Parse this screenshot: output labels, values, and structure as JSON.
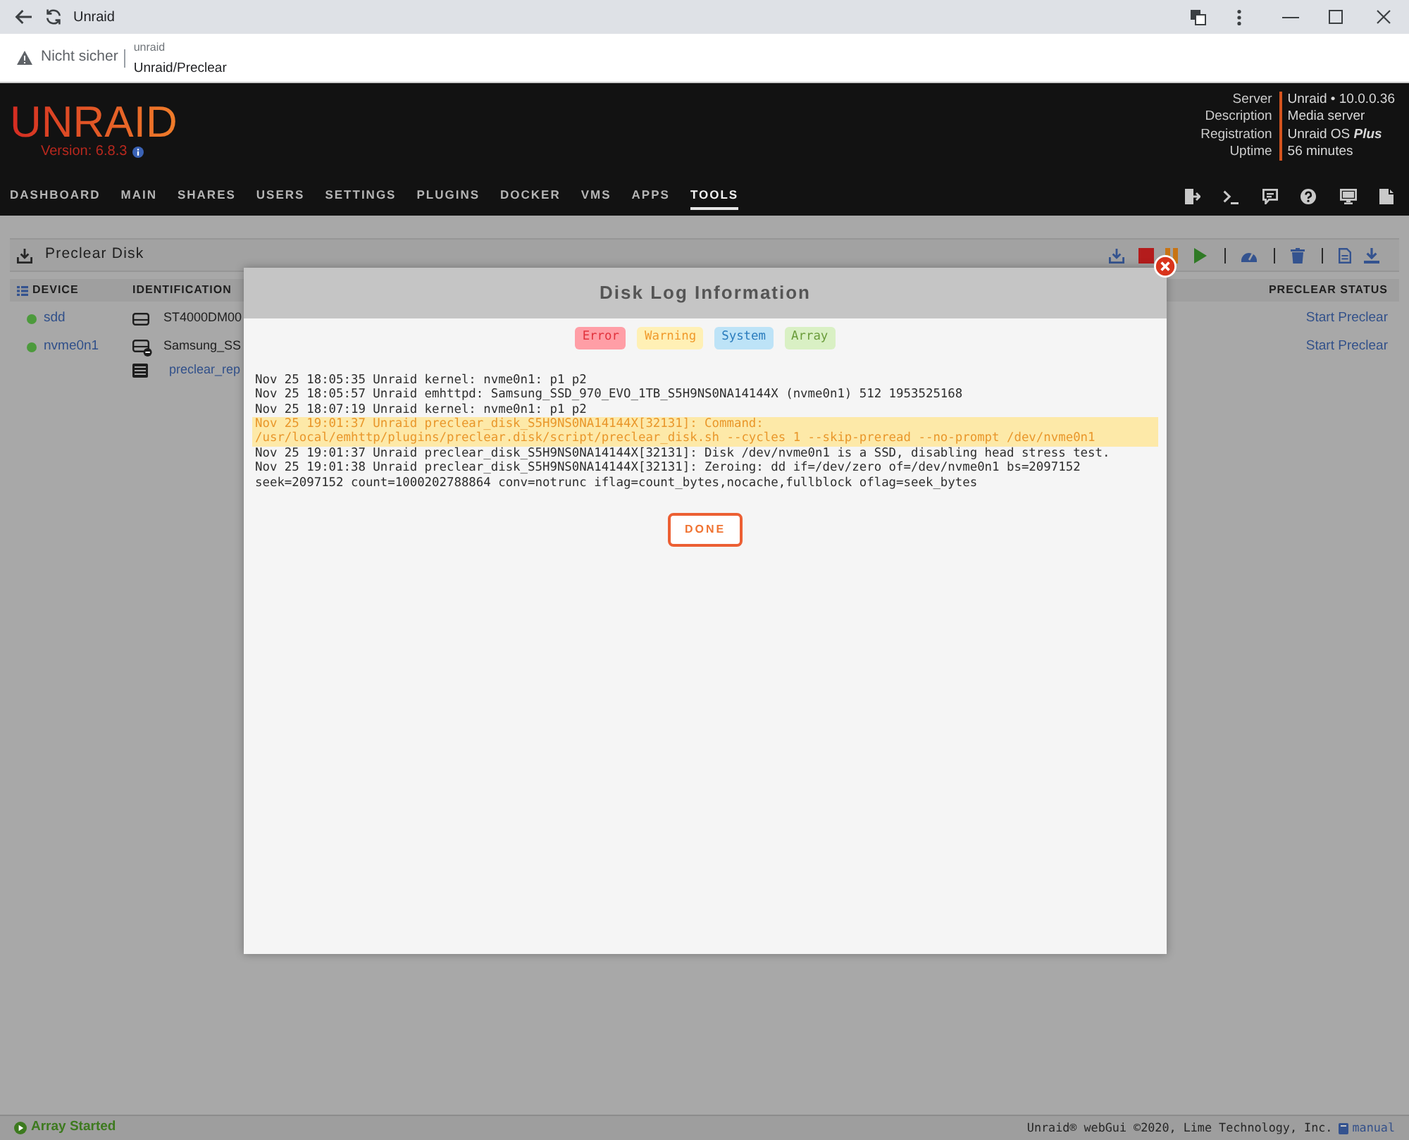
{
  "browser": {
    "tab_title": "Unraid",
    "security_label": "Nicht sicher",
    "site_name": "unraid",
    "page_title": "Unraid/Preclear"
  },
  "header": {
    "logo": "UNRAID",
    "version": "Version: 6.8.3",
    "server_info": [
      {
        "label": "Server",
        "value": "Unraid • 10.0.0.36"
      },
      {
        "label": "Description",
        "value": "Media server"
      },
      {
        "label": "Registration",
        "value": "Unraid OS *Plus*"
      },
      {
        "label": "Uptime",
        "value": "56 minutes"
      }
    ]
  },
  "nav": {
    "items": [
      {
        "label": "DASHBOARD",
        "selected": false
      },
      {
        "label": "MAIN",
        "selected": false
      },
      {
        "label": "SHARES",
        "selected": false
      },
      {
        "label": "USERS",
        "selected": false
      },
      {
        "label": "SETTINGS",
        "selected": false
      },
      {
        "label": "PLUGINS",
        "selected": false
      },
      {
        "label": "DOCKER",
        "selected": false
      },
      {
        "label": "VMS",
        "selected": false
      },
      {
        "label": "APPS",
        "selected": false
      },
      {
        "label": "TOOLS",
        "selected": true
      }
    ]
  },
  "panel": {
    "title": "Preclear Disk",
    "columns": [
      "DEVICE",
      "IDENTIFICATION",
      "PRECLEAR STATUS"
    ],
    "rows": [
      {
        "device": "sdd",
        "color": "#4c9a3c",
        "identification": "ST4000DM00",
        "badged": false,
        "status": "Start Preclear"
      },
      {
        "device": "nvme0n1",
        "color": "#4c9a3c",
        "identification": "Samsung_SS",
        "badged": true,
        "report": "preclear_rep",
        "status": "Start Preclear"
      }
    ]
  },
  "dialog": {
    "title": "Disk Log Information",
    "filters": [
      {
        "label": "Error",
        "kind": "error"
      },
      {
        "label": "Warning",
        "kind": "warning"
      },
      {
        "label": "System",
        "kind": "system"
      },
      {
        "label": "Array",
        "kind": "array"
      }
    ],
    "log": [
      {
        "kind": "plain",
        "text": "Nov 25 18:05:35 Unraid kernel: nvme0n1: p1 p2"
      },
      {
        "kind": "plain",
        "text": "Nov 25 18:05:57 Unraid emhttpd: Samsung_SSD_970_EVO_1TB_S5H9NS0NA14144X (nvme0n1) 512 1953525168"
      },
      {
        "kind": "plain",
        "text": "Nov 25 18:07:19 Unraid kernel: nvme0n1: p1 p2"
      },
      {
        "kind": "warning",
        "text": "Nov 25 19:01:37 Unraid preclear_disk_S5H9NS0NA14144X[32131]: Command: /usr/local/emhttp/plugins/preclear.disk/script/preclear_disk.sh --cycles 1 --skip-preread --no-prompt /dev/nvme0n1"
      },
      {
        "kind": "plain",
        "text": "Nov 25 19:01:37 Unraid preclear_disk_S5H9NS0NA14144X[32131]: Disk /dev/nvme0n1 is a SSD, disabling head stress test."
      },
      {
        "kind": "plain",
        "text": "Nov 25 19:01:38 Unraid preclear_disk_S5H9NS0NA14144X[32131]: Zeroing: dd if=/dev/zero of=/dev/nvme0n1 bs=2097152 seek=2097152 count=1000202788864 conv=notrunc iflag=count_bytes,nocache,fullblock oflag=seek_bytes"
      }
    ],
    "button": "DONE"
  },
  "footer": {
    "status": "Array Started",
    "copyright": "Unraid® webGui ©2020, Lime Technology, Inc.",
    "manual_link": "manual"
  }
}
